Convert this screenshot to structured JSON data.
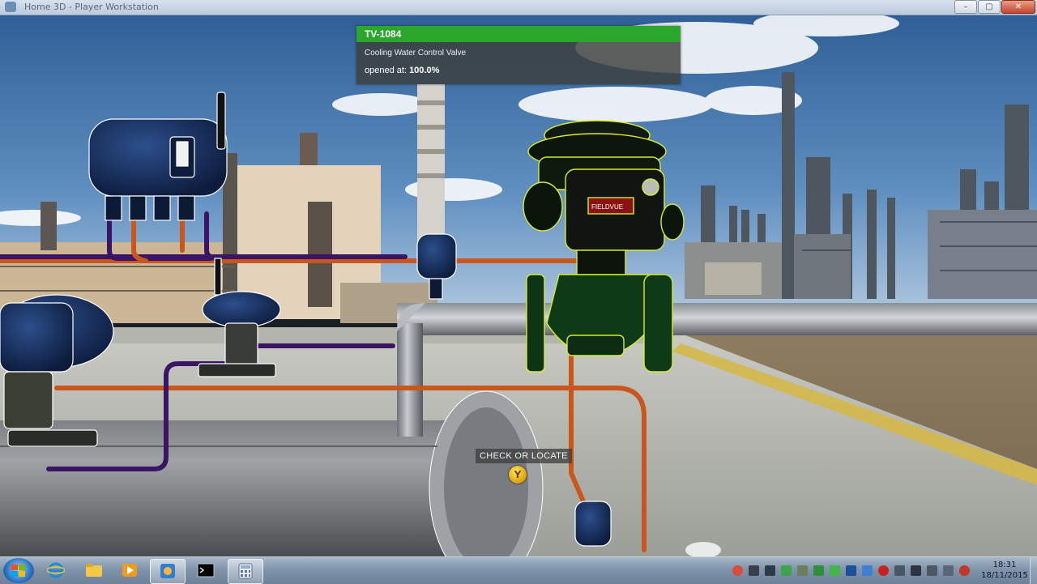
{
  "window": {
    "title": "Home 3D - Player Workstation",
    "buttons": {
      "minimize": "–",
      "maximize": "▢",
      "close": "✕"
    }
  },
  "tag_panel": {
    "tag": "TV-1084",
    "description": "Cooling Water Control Valve",
    "opened_label": "opened at:",
    "opened_value": "100.0%",
    "header_color": "#2aa62b"
  },
  "valve": {
    "nameplate": "FIELDVUE"
  },
  "prompt": {
    "label": "CHECK OR LOCATE",
    "button": "Y"
  },
  "taskbar": {
    "items": [
      {
        "name": "internet-explorer-icon",
        "active": false
      },
      {
        "name": "file-explorer-icon",
        "active": false
      },
      {
        "name": "media-player-icon",
        "active": false
      },
      {
        "name": "app-icon",
        "active": true
      },
      {
        "name": "command-prompt-icon",
        "active": false
      },
      {
        "name": "calculator-icon",
        "active": true
      }
    ],
    "time": "18:31",
    "date": "18/11/2015"
  }
}
